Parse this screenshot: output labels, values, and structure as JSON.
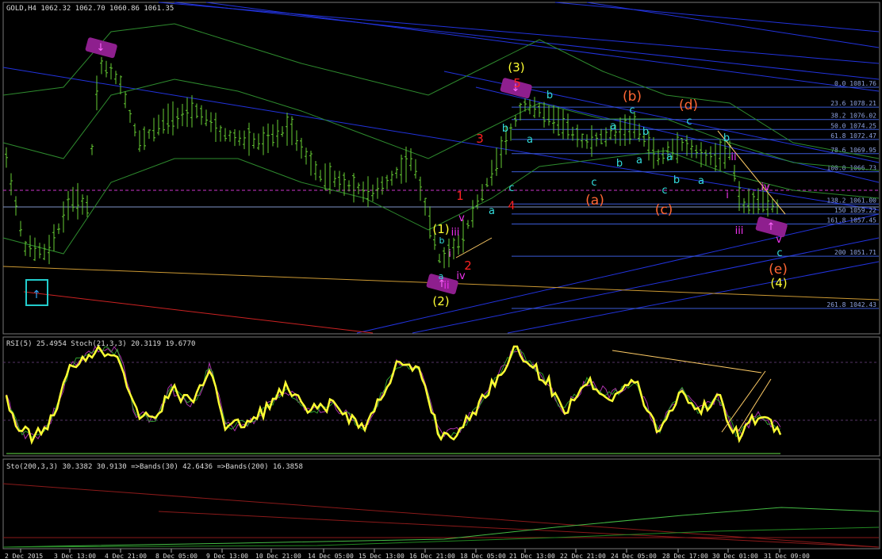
{
  "window": {
    "title": "GOLD,H4 1062.32 1062.70 1060.86 1061.35"
  },
  "panels": {
    "rsi_header": "RSI(5) 25.4954 Stoch(21,3,3) 20.3119 19.6770",
    "sto_header": "Sto(200,3,3) 30.3382 30.9130 =>Bands(30) 42.6436 =>Bands(200) 16.3858"
  },
  "colors": {
    "price_bars": "#66cc33",
    "envelope": "#2e8b2e",
    "channel": "#2233dd",
    "fib_lines": "#3b5bd6",
    "support": "#cc9933",
    "red_trend": "#cc2222",
    "rsi": "#ffff33",
    "stoch_main": "#2e9b2e",
    "stoch_signal": "#aa33aa",
    "magenta_marker": "#8e1f8e",
    "cyan_box": "#22cccc",
    "pink_dash": "#cc33cc"
  },
  "chart_data": {
    "type": "candlestick-ohlc",
    "symbol": "GOLD",
    "timeframe": "H4",
    "ohlc_last": {
      "open": 1062.32,
      "high": 1062.7,
      "low": 1060.86,
      "close": 1061.35
    },
    "x_ticks": [
      "2 Dec 2015",
      "3 Dec 13:00",
      "4 Dec 21:00",
      "8 Dec 05:00",
      "9 Dec 13:00",
      "10 Dec 21:00",
      "14 Dec 05:00",
      "15 Dec 13:00",
      "16 Dec 21:00",
      "18 Dec 05:00",
      "21 Dec 13:00",
      "22 Dec 21:00",
      "24 Dec 05:00",
      "28 Dec 17:00",
      "30 Dec 01:00",
      "31 Dec 09:00"
    ],
    "fib_levels": [
      {
        "label": "0.0",
        "price": 1081.76
      },
      {
        "label": "23.6",
        "price": 1078.21
      },
      {
        "label": "38.2",
        "price": 1076.02
      },
      {
        "label": "50.0",
        "price": 1074.25
      },
      {
        "label": "61.8",
        "price": 1072.47
      },
      {
        "label": "78.6",
        "price": 1069.95
      },
      {
        "label": "100.0",
        "price": 1066.73
      },
      {
        "label": "138.2",
        "price": 1061.0
      },
      {
        "label": "150",
        "price": 1059.22
      },
      {
        "label": "161.8",
        "price": 1057.45
      },
      {
        "label": "200",
        "price": 1051.71
      },
      {
        "label": "261.8",
        "price": 1042.43
      }
    ],
    "wave_labels": [
      {
        "text": "(1)",
        "color": "#ffff33"
      },
      {
        "text": "(2)",
        "color": "#ffff33"
      },
      {
        "text": "(3)",
        "color": "#ffff33"
      },
      {
        "text": "(4)",
        "color": "#ffff33"
      },
      {
        "text": "(a)",
        "color": "#ff6633"
      },
      {
        "text": "(b)",
        "color": "#ff6633"
      },
      {
        "text": "(c)",
        "color": "#ff6633"
      },
      {
        "text": "(d)",
        "color": "#ff6633"
      },
      {
        "text": "(e)",
        "color": "#ff6633"
      },
      {
        "text": "1",
        "color": "#ff2222"
      },
      {
        "text": "2",
        "color": "#ff2222"
      },
      {
        "text": "3",
        "color": "#ff2222"
      },
      {
        "text": "4",
        "color": "#ff2222"
      },
      {
        "text": "5",
        "color": "#ff2222"
      },
      {
        "text": "a",
        "color": "#33dddd"
      },
      {
        "text": "b",
        "color": "#33dddd"
      },
      {
        "text": "c",
        "color": "#33dddd"
      },
      {
        "text": "i",
        "color": "#ee33ee"
      },
      {
        "text": "ii",
        "color": "#ee33ee"
      },
      {
        "text": "iii",
        "color": "#ee33ee"
      },
      {
        "text": "iv",
        "color": "#ee33ee"
      },
      {
        "text": "v",
        "color": "#ee33ee"
      }
    ]
  }
}
